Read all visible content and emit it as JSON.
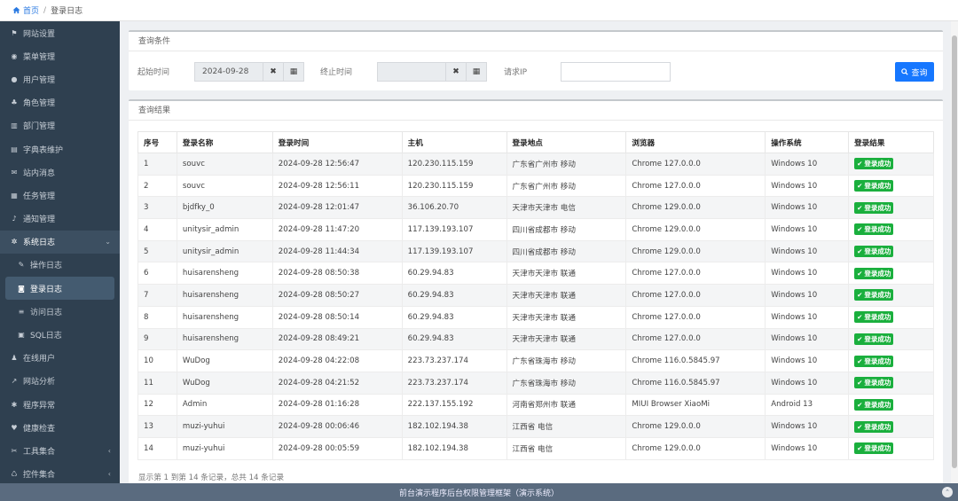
{
  "breadcrumb": {
    "home": "首页",
    "separator": "/",
    "current": "登录日志"
  },
  "sidebar": {
    "items": [
      {
        "label": "网站设置",
        "icon": "flag-icon"
      },
      {
        "label": "菜单管理",
        "icon": "dashboard-icon"
      },
      {
        "label": "用户管理",
        "icon": "user-icon"
      },
      {
        "label": "角色管理",
        "icon": "sitemap-icon"
      },
      {
        "label": "部门管理",
        "icon": "bank-icon"
      },
      {
        "label": "字典表维护",
        "icon": "book-icon"
      },
      {
        "label": "站内消息",
        "icon": "envelope-icon"
      },
      {
        "label": "任务管理",
        "icon": "tasks-icon"
      },
      {
        "label": "通知管理",
        "icon": "bell-icon"
      },
      {
        "label": "系统日志",
        "icon": "cogs-icon",
        "arrow": "⌄"
      },
      {
        "label": "操作日志",
        "icon": "edit-icon"
      },
      {
        "label": "登录日志",
        "icon": "circle-user-icon"
      },
      {
        "label": "访问日志",
        "icon": "list-icon"
      },
      {
        "label": "SQL日志",
        "icon": "database-icon"
      },
      {
        "label": "在线用户",
        "icon": "users-icon"
      },
      {
        "label": "网站分析",
        "icon": "chart-icon"
      },
      {
        "label": "程序异常",
        "icon": "bug-icon"
      },
      {
        "label": "健康检查",
        "icon": "heartbeat-icon"
      },
      {
        "label": "工具集合",
        "icon": "wrench-icon",
        "arrow": "‹"
      },
      {
        "label": "控件集合",
        "icon": "widget-icon",
        "arrow": "‹"
      }
    ]
  },
  "query": {
    "title": "查询条件",
    "start_label": "起始时间",
    "start_value": "2024-09-28",
    "end_label": "终止时间",
    "end_value": "",
    "ip_label": "请求IP",
    "ip_value": "",
    "clear_symbol": "✖",
    "calendar_symbol": "▦",
    "search_label": "查询"
  },
  "result": {
    "title": "查询结果",
    "headers": [
      "序号",
      "登录名称",
      "登录时间",
      "主机",
      "登录地点",
      "浏览器",
      "操作系统",
      "登录结果"
    ],
    "rows": [
      [
        "1",
        "souvc",
        "2024-09-28 12:56:47",
        "120.230.115.159",
        "广东省广州市 移动",
        "Chrome 127.0.0.0",
        "Windows 10",
        "登录成功"
      ],
      [
        "2",
        "souvc",
        "2024-09-28 12:56:11",
        "120.230.115.159",
        "广东省广州市 移动",
        "Chrome 127.0.0.0",
        "Windows 10",
        "登录成功"
      ],
      [
        "3",
        "bjdfky_0",
        "2024-09-28 12:01:47",
        "36.106.20.70",
        "天津市天津市 电信",
        "Chrome 129.0.0.0",
        "Windows 10",
        "登录成功"
      ],
      [
        "4",
        "unitysir_admin",
        "2024-09-28 11:47:20",
        "117.139.193.107",
        "四川省成都市 移动",
        "Chrome 129.0.0.0",
        "Windows 10",
        "登录成功"
      ],
      [
        "5",
        "unitysir_admin",
        "2024-09-28 11:44:34",
        "117.139.193.107",
        "四川省成都市 移动",
        "Chrome 129.0.0.0",
        "Windows 10",
        "登录成功"
      ],
      [
        "6",
        "huisarensheng",
        "2024-09-28 08:50:38",
        "60.29.94.83",
        "天津市天津市 联通",
        "Chrome 127.0.0.0",
        "Windows 10",
        "登录成功"
      ],
      [
        "7",
        "huisarensheng",
        "2024-09-28 08:50:27",
        "60.29.94.83",
        "天津市天津市 联通",
        "Chrome 127.0.0.0",
        "Windows 10",
        "登录成功"
      ],
      [
        "8",
        "huisarensheng",
        "2024-09-28 08:50:14",
        "60.29.94.83",
        "天津市天津市 联通",
        "Chrome 127.0.0.0",
        "Windows 10",
        "登录成功"
      ],
      [
        "9",
        "huisarensheng",
        "2024-09-28 08:49:21",
        "60.29.94.83",
        "天津市天津市 联通",
        "Chrome 127.0.0.0",
        "Windows 10",
        "登录成功"
      ],
      [
        "10",
        "WuDog",
        "2024-09-28 04:22:08",
        "223.73.237.174",
        "广东省珠海市 移动",
        "Chrome 116.0.5845.97",
        "Windows 10",
        "登录成功"
      ],
      [
        "11",
        "WuDog",
        "2024-09-28 04:21:52",
        "223.73.237.174",
        "广东省珠海市 移动",
        "Chrome 116.0.5845.97",
        "Windows 10",
        "登录成功"
      ],
      [
        "12",
        "Admin",
        "2024-09-28 01:16:28",
        "222.137.155.192",
        "河南省郑州市 联通",
        "MIUI Browser XiaoMi",
        "Android 13",
        "登录成功"
      ],
      [
        "13",
        "muzi-yuhui",
        "2024-09-28 00:06:46",
        "182.102.194.38",
        "江西省 电信",
        "Chrome 129.0.0.0",
        "Windows 10",
        "登录成功"
      ],
      [
        "14",
        "muzi-yuhui",
        "2024-09-28 00:05:59",
        "182.102.194.38",
        "江西省 电信",
        "Chrome 129.0.0.0",
        "Windows 10",
        "登录成功"
      ]
    ],
    "summary": "显示第 1 到第 14 条记录，总共 14 条记录"
  },
  "footer": {
    "text": "前台演示程序后台权限管理框架（演示系统）",
    "up_symbol": "⌃"
  },
  "colors": {
    "sidebar_bg": "#2f4050",
    "primary": "#1677ff",
    "success": "#1aaf3d",
    "footer_bg": "#5a6b7f"
  }
}
